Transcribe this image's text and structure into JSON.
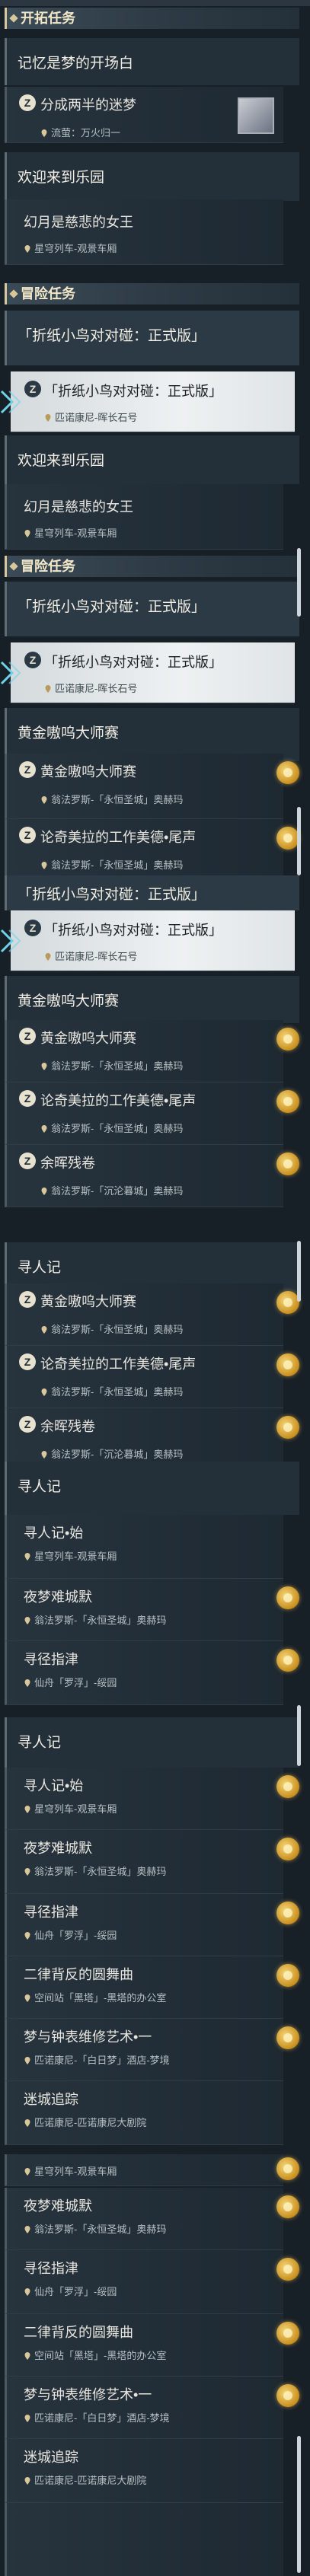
{
  "sections": {
    "trailblaze": "开拓任务",
    "adventure": "冒险任务"
  },
  "groups": {
    "memory_beginning": "记忆是梦的开场白",
    "welcome_paradise": "欢迎来到乐园",
    "golden_showdown": "黄金嗷呜大师赛",
    "seeker_notes": "寻人记"
  },
  "quests": {
    "split_wandering": {
      "name": "分成两半的迷梦",
      "loc": "流萤：万火归一"
    },
    "moon_queen": {
      "name": "幻月是慈悲的女王",
      "loc": "星穹列车-观景车厢"
    },
    "origami_bird": {
      "name": "「折纸小鸟对对碰：正式版」",
      "loc": "匹诺康尼-晖长石号"
    },
    "golden_master": {
      "name": "黄金嗷呜大师赛",
      "loc": "翁法罗斯-「永恒圣城」奥赫玛"
    },
    "lunqi_workshop": {
      "name": "论奇美拉的工作美德•尾声",
      "loc": "翁法罗斯-「永恒圣城」奥赫玛"
    },
    "ember_scroll": {
      "name": "余晖残卷",
      "loc": "翁法罗斯-「沉沦暮城」奥赫玛"
    },
    "seeker_begin": {
      "name": "寻人记•始",
      "loc": "星穹列车-观景车厢"
    },
    "nightmare_city": {
      "name": "夜梦难城默",
      "loc": "翁法罗斯-「永恒圣城」奥赫玛"
    },
    "seek_guide": {
      "name": "寻径指津",
      "loc": "仙舟「罗浮」-绥园"
    },
    "two_rhythm": {
      "name": "二律背反的圆舞曲",
      "loc": "空间站「黑塔」-黑塔的办公室"
    },
    "dream_clock": {
      "name": "梦与钟表维修艺术•一",
      "loc": "匹诺康尼-「白日梦」酒店-梦境"
    },
    "maze_pursuit": {
      "name": "迷城追踪",
      "loc": "匹诺康尼-匹诺康尼大剧院"
    }
  },
  "icons": {
    "quest_badge_glyph": "Z",
    "reward_color": "#e0b040",
    "accent": "#d8c79a"
  }
}
